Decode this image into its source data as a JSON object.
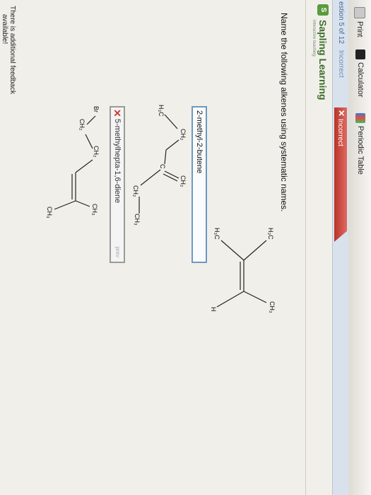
{
  "toolbar": {
    "print_label": "Print",
    "calculator_label": "Calculator",
    "periodic_table_label": "Periodic Table"
  },
  "status": {
    "question_progress": "estion 5 of 12",
    "result_small": "Incorrect",
    "result_badge": "Incorrect"
  },
  "brand": {
    "name": "Sapling Learning",
    "tagline": "interactive teaching"
  },
  "question": {
    "prompt": "Name the following alkenes using systematic names."
  },
  "molecule_1": {
    "labels": {
      "h3c_top": "H₃C",
      "ch3": "CH₃",
      "h3c_bottom": "H₃C",
      "h": "H"
    }
  },
  "answer_1": {
    "value": "2-methyl-2-butene"
  },
  "molecule_2": {
    "labels": {
      "ch2_top": "CH₂",
      "h3c": "H₃C",
      "ch2_left": "CH₂",
      "c": "C",
      "ch2_right": "CH₂",
      "ch3": "CH₃"
    }
  },
  "answer_2": {
    "value": "5-methylhepta-1,6-diene",
    "prev_tag": "prev"
  },
  "molecule_3": {
    "labels": {
      "br": "Br",
      "ch2_a": "CH₂",
      "ch2_b": "CH₂",
      "ch3_right": "CH₃",
      "ch3_bottom": "CH₃"
    }
  },
  "feedback": {
    "line1": "There is additional feedback",
    "line2": "available!"
  }
}
